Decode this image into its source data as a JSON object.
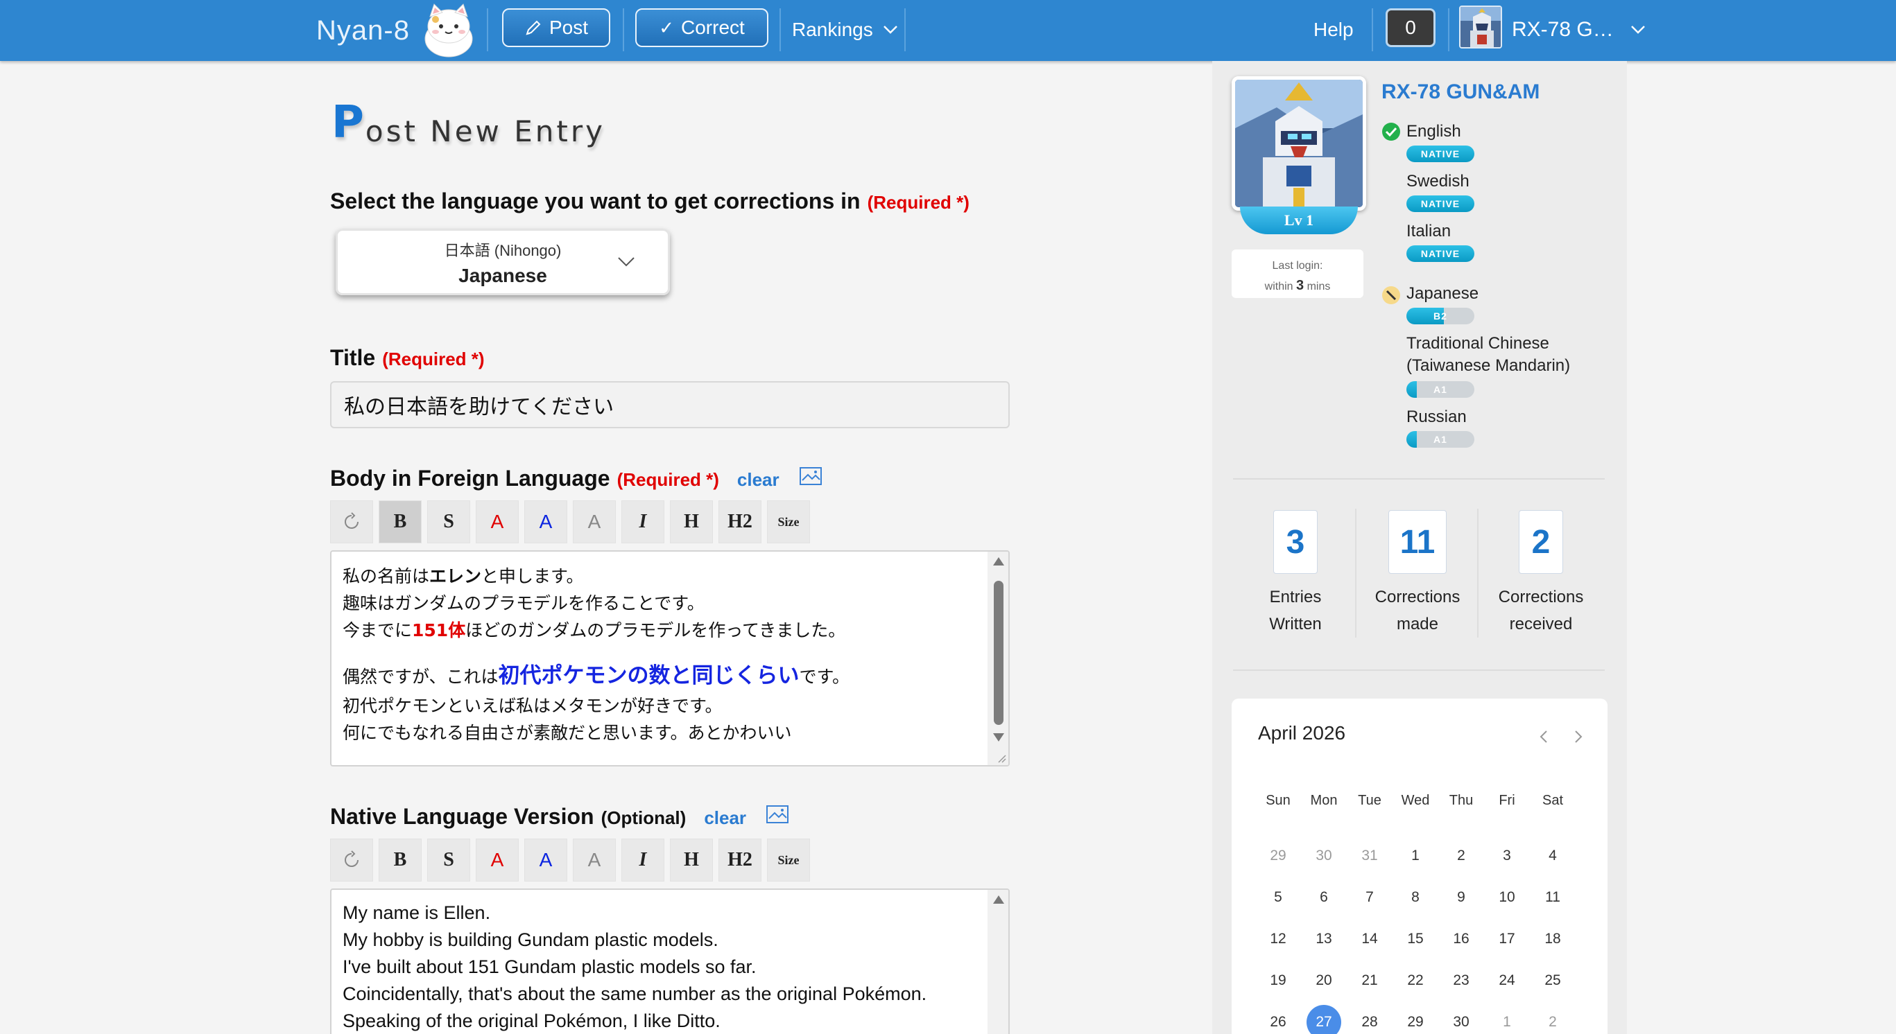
{
  "nav": {
    "brand": "Nyan-8",
    "post_label": "Post",
    "correct_label": "Correct",
    "rankings_label": "Rankings",
    "help_label": "Help",
    "notification_count": "0",
    "username": "RX-78 G…",
    "colors": {
      "bar": "#2e86d0",
      "button": "#2170b8"
    }
  },
  "page": {
    "title_first": "P",
    "title_rest": "ost New Entry"
  },
  "language_section": {
    "label": "Select the language you want to get corrections in",
    "required": "(Required *)",
    "selected_native": "日本語 (Nihongo)",
    "selected_english": "Japanese"
  },
  "title_section": {
    "label": "Title",
    "required": "(Required *)",
    "value": "私の日本語を助けてください"
  },
  "body_section": {
    "label": "Body in Foreign Language",
    "required": "(Required *)",
    "clear": "clear",
    "toolbar": [
      "B",
      "S",
      "A",
      "A",
      "A",
      "I",
      "H",
      "H2",
      "Size"
    ],
    "lines": {
      "l1a": "私の名前は",
      "l1b": "エレン",
      "l1c": "と申します。",
      "l2": "趣味はガンダムのプラモデルを作ることです。",
      "l3a": "今までに",
      "l3b": "151体",
      "l3c": "ほどのガンダムのプラモデルを作ってきました。",
      "l4a": "偶然ですが、これは",
      "l4b": "初代ポケモンの数と同じくらい",
      "l4c": "です。",
      "l5": "初代ポケモンといえば私はメタモンが好きです。",
      "l6": "何にでもなれる自由さが素敵だと思います。あとかわいい"
    }
  },
  "native_section": {
    "label": "Native Language Version",
    "optional": "(Optional)",
    "clear": "clear",
    "toolbar": [
      "B",
      "S",
      "A",
      "A",
      "A",
      "I",
      "H",
      "H2",
      "Size"
    ],
    "lines": [
      "My name is Ellen.",
      "My hobby is building Gundam plastic models.",
      "I've built about 151 Gundam plastic models so far.",
      "Coincidentally, that's about the same number as the original Pokémon.",
      "Speaking of the original Pokémon, I like Ditto."
    ]
  },
  "profile": {
    "name": "RX-78 GUN&AM",
    "level": "Lv 1",
    "last_login_label": "Last login:",
    "last_login_prefix": "within",
    "last_login_value": "3",
    "last_login_suffix": "mins",
    "native_languages": [
      {
        "name": "English",
        "badge": "NATIVE"
      },
      {
        "name": "Swedish",
        "badge": "NATIVE"
      },
      {
        "name": "Italian",
        "badge": "NATIVE"
      }
    ],
    "learning_languages": [
      {
        "name": "Japanese",
        "badge": "B2",
        "level": 0.55
      },
      {
        "name_line1": "Traditional Chinese",
        "name_line2": "(Taiwanese Mandarin)",
        "badge": "A1",
        "level": 0.15
      },
      {
        "name": "Russian",
        "badge": "A1",
        "level": 0.15
      }
    ],
    "stats": [
      {
        "value": "3",
        "line1": "Entries",
        "line2": "Written"
      },
      {
        "value": "11",
        "line1": "Corrections",
        "line2": "made"
      },
      {
        "value": "2",
        "line1": "Corrections",
        "line2": "received"
      }
    ]
  },
  "calendar": {
    "month_label": "April 2026",
    "weekdays": [
      "Sun",
      "Mon",
      "Tue",
      "Wed",
      "Thu",
      "Fri",
      "Sat"
    ],
    "weeks": [
      [
        "29",
        "30",
        "31",
        "1",
        "2",
        "3",
        "4"
      ],
      [
        "5",
        "6",
        "7",
        "8",
        "9",
        "10",
        "11"
      ],
      [
        "12",
        "13",
        "14",
        "15",
        "16",
        "17",
        "18"
      ],
      [
        "19",
        "20",
        "21",
        "22",
        "23",
        "24",
        "25"
      ],
      [
        "26",
        "27",
        "28",
        "29",
        "30",
        "1",
        "2"
      ]
    ],
    "today": "27"
  }
}
